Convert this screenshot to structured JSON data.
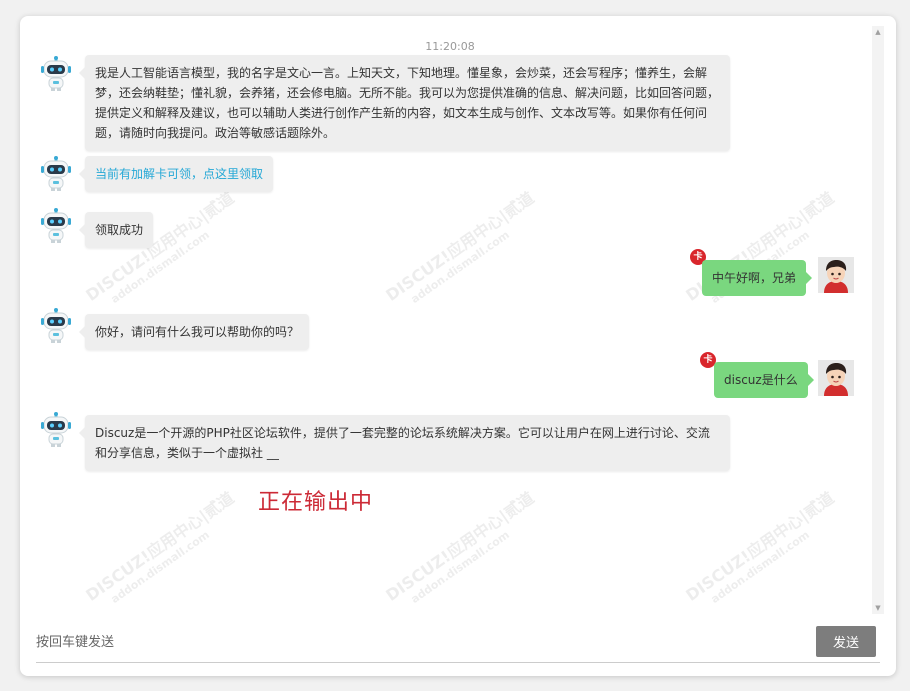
{
  "chat": {
    "timestamp": "11:20:08",
    "messages": [
      {
        "from": "bot",
        "text": "我是人工智能语言模型，我的名字是文心一言。上知天文，下知地理。懂星象，会炒菜，还会写程序；懂养生，会解梦，还会纳鞋垫；懂礼貌，会养猪，还会修电脑。无所不能。我可以为您提供准确的信息、解决问题，比如回答问题，提供定义和解释及建议，也可以辅助人类进行创作产生新的内容，如文本生成与创作、文本改写等。如果你有任何问题，请随时向我提问。政治等敏感话题除外。"
      },
      {
        "from": "bot",
        "text": "当前有加解卡可领，点这里领取",
        "link": true
      },
      {
        "from": "bot",
        "text": "领取成功"
      },
      {
        "from": "user",
        "text": "中午好啊，兄弟",
        "badge": "卡"
      },
      {
        "from": "bot",
        "text": "你好，请问有什么我可以帮助你的吗？"
      },
      {
        "from": "user",
        "text": "discuz是什么",
        "badge": "卡"
      },
      {
        "from": "bot",
        "text": "Discuz是一个开源的PHP社区论坛软件，提供了一套完整的论坛系统解决方案。它可以让用户在网上进行讨论、交流和分享信息，类似于一个虚拟社 __"
      }
    ],
    "status": "正在输出中"
  },
  "watermark": {
    "brand": "DISCUZ!应用中心|贰道",
    "site": "addon.dismall.com"
  },
  "input": {
    "placeholder": "按回车键发送",
    "send_label": "发送"
  },
  "icons": {
    "bot_avatar": "robot-icon",
    "user_avatar": "boy-avatar-icon",
    "scroll_up": "triangle-up-icon",
    "scroll_down": "triangle-down-icon"
  },
  "colors": {
    "user_bubble": "#7ad77f",
    "bot_bubble": "#eeeeee",
    "link": "#25a8d6",
    "status": "#cc2a36",
    "badge": "#d9262c",
    "send_button": "#7d7d7d"
  }
}
